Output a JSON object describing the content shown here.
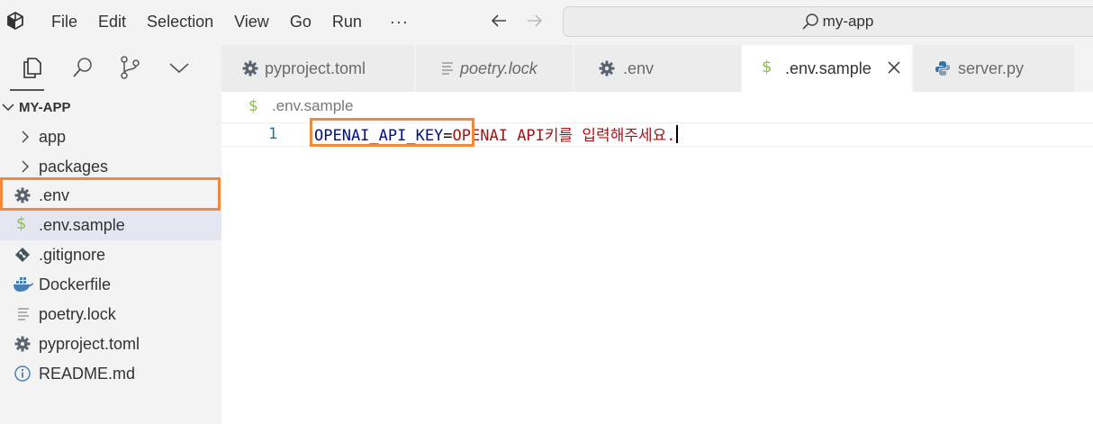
{
  "titlebar": {
    "menu": [
      "File",
      "Edit",
      "Selection",
      "View",
      "Go",
      "Run"
    ],
    "more": "···",
    "search_text": "my-app"
  },
  "sidebar": {
    "title": "MY-APP",
    "items": [
      {
        "label": "app",
        "icon": "chevron-right-icon"
      },
      {
        "label": "packages",
        "icon": "chevron-right-icon"
      },
      {
        "label": ".env",
        "icon": "gear-icon"
      },
      {
        "label": ".env.sample",
        "icon": "dollar-icon"
      },
      {
        "label": ".gitignore",
        "icon": "git-icon"
      },
      {
        "label": "Dockerfile",
        "icon": "docker-icon"
      },
      {
        "label": "poetry.lock",
        "icon": "lines-icon"
      },
      {
        "label": "pyproject.toml",
        "icon": "gear-icon"
      },
      {
        "label": "README.md",
        "icon": "info-icon"
      }
    ]
  },
  "tabs": [
    {
      "label": "pyproject.toml",
      "icon": "gear-icon"
    },
    {
      "label": "poetry.lock",
      "icon": "lines-icon"
    },
    {
      "label": ".env",
      "icon": "gear-icon"
    },
    {
      "label": ".env.sample",
      "icon": "dollar-icon",
      "active": true
    },
    {
      "label": "server.py",
      "icon": "python-icon"
    }
  ],
  "editor": {
    "breadcrumb": ".env.sample",
    "line_number": "1",
    "code_key": "OPENAI_API_KEY",
    "code_eq": "=",
    "code_value": "OPENAI API키를 입력해주세요."
  },
  "colors": {
    "highlight": "#f0883e",
    "dollar": "#8dc149",
    "python": "#3572a5"
  }
}
